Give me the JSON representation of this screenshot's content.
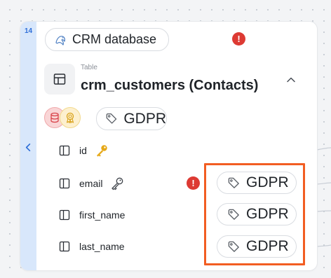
{
  "node": {
    "count": "14",
    "database": {
      "name": "CRM database",
      "icon": "mysql-dolphin-icon"
    },
    "table": {
      "kind_label": "Table",
      "title": "crm_customers (Contacts)"
    },
    "table_tag": "GDPR",
    "columns": [
      {
        "name": "id",
        "key": "primary-key-icon"
      },
      {
        "name": "email",
        "key": "key-outline-icon",
        "tag": "GDPR",
        "warning": "!"
      },
      {
        "name": "first_name",
        "tag": "GDPR"
      },
      {
        "name": "last_name",
        "tag": "GDPR"
      }
    ],
    "warning_glyph": "!"
  },
  "colors": {
    "rail": "#d8e7fb",
    "accent": "#2f6fd8",
    "warning": "#dd3a33",
    "highlight": "#f25d22",
    "key_gold": "#e6a817"
  }
}
